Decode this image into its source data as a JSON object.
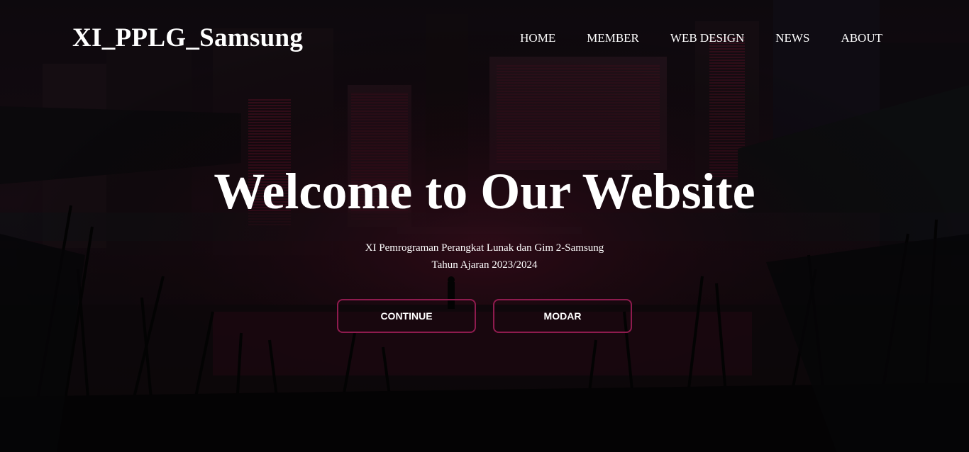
{
  "brand": {
    "title": "XI_PPLG_Samsung"
  },
  "nav": {
    "items": [
      {
        "label": "HOME"
      },
      {
        "label": "MEMBER"
      },
      {
        "label": "WEB DESIGN"
      },
      {
        "label": "NEWS"
      },
      {
        "label": "ABOUT"
      }
    ]
  },
  "hero": {
    "heading": "Welcome to Our Website",
    "subtitle_line1": "XI Pemrograman Perangkat Lunak dan Gim 2-Samsung",
    "subtitle_line2": "Tahun Ajaran 2023/2024"
  },
  "buttons": {
    "continue_label": "CONTINUE",
    "modar_label": "MODAR"
  },
  "colors": {
    "background": "#0b0a0d",
    "accent": "#8e1b4e",
    "text": "#ffffff"
  }
}
